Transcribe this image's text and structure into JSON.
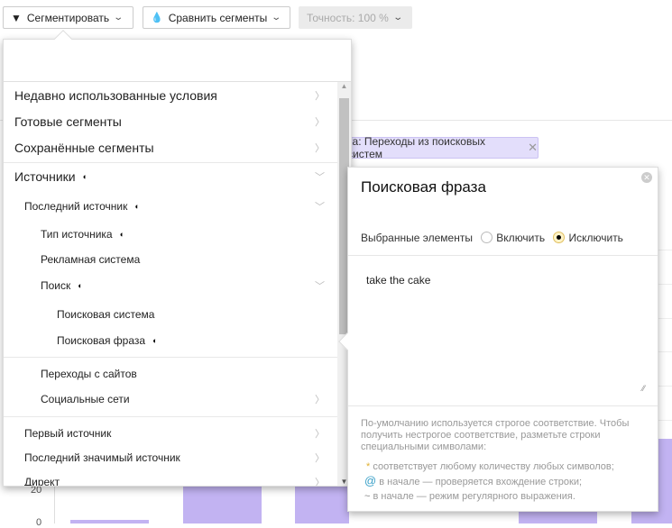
{
  "toolbar": {
    "segment_label": "Сегментировать",
    "compare_label": "Сравнить сегменты",
    "accuracy_label": "Точность: 100 %"
  },
  "filter_chip": {
    "label": "ка: Переходы из поисковых систем"
  },
  "chart": {
    "y_ticks": [
      "20",
      "0"
    ]
  },
  "dropdown": {
    "search_value": "",
    "items": [
      {
        "label": "Недавно использованные условия"
      },
      {
        "label": "Готовые сегменты"
      },
      {
        "label": "Сохранённые сегменты"
      },
      {
        "label": "Источники"
      },
      {
        "label": "Последний источник"
      },
      {
        "label": "Тип источника"
      },
      {
        "label": "Рекламная система"
      },
      {
        "label": "Поиск"
      },
      {
        "label": "Поисковая система"
      },
      {
        "label": "Поисковая фраза"
      },
      {
        "label": "Переходы с сайтов"
      },
      {
        "label": "Социальные сети"
      },
      {
        "label": "Первый источник"
      },
      {
        "label": "Последний значимый источник"
      },
      {
        "label": "Директ"
      }
    ]
  },
  "popover": {
    "title": "Поисковая фраза",
    "selected_label": "Выбранные элементы",
    "include_label": "Включить",
    "exclude_label": "Исключить",
    "selected_option": "Исключить",
    "textarea_value": "take the cake",
    "help_text": "По-умолчанию используется строгое соответствие. Чтобы получить нестрогое соответствие, разметьте строки специальными символами:",
    "rules": [
      {
        "symbol": "*",
        "text": " соответствует любому количеству любых символов;"
      },
      {
        "symbol": "@",
        "text": " в начале — проверяется вхождение строки;"
      },
      {
        "symbol": "~",
        "text": " в начале — режим регулярного выражения."
      }
    ]
  },
  "colors": {
    "bar": "#c2b3f2",
    "chip": "#e3defb",
    "accent": "#3aa0c8"
  }
}
